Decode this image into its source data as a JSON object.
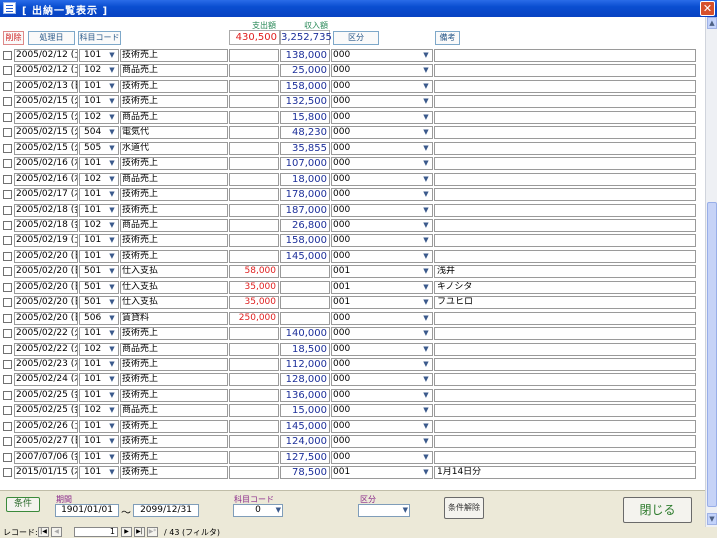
{
  "window": {
    "title": "[ 出納一覧表示 ]",
    "close_glyph": "✕"
  },
  "header": {
    "delete_label": "削除",
    "date_label": "処理日",
    "code_label": "科目コード",
    "out_label": "支出額",
    "in_label": "収入額",
    "out_total": "430,500",
    "in_total": "3,252,735",
    "kbn_label": "区分",
    "note_label": "備考"
  },
  "rows": [
    {
      "date": "2005/02/12 (土)",
      "code": "101",
      "name": "技術売上",
      "out": "",
      "in": "138,000",
      "kbn": "000",
      "note": ""
    },
    {
      "date": "2005/02/12 (土)",
      "code": "102",
      "name": "商品売上",
      "out": "",
      "in": "25,000",
      "kbn": "000",
      "note": ""
    },
    {
      "date": "2005/02/13 (日)",
      "code": "101",
      "name": "技術売上",
      "out": "",
      "in": "158,000",
      "kbn": "000",
      "note": ""
    },
    {
      "date": "2005/02/15 (火)",
      "code": "101",
      "name": "技術売上",
      "out": "",
      "in": "132,500",
      "kbn": "000",
      "note": ""
    },
    {
      "date": "2005/02/15 (火)",
      "code": "102",
      "name": "商品売上",
      "out": "",
      "in": "15,800",
      "kbn": "000",
      "note": ""
    },
    {
      "date": "2005/02/15 (火)",
      "code": "504",
      "name": "電気代",
      "out": "",
      "in": "48,230",
      "kbn": "000",
      "note": ""
    },
    {
      "date": "2005/02/15 (火)",
      "code": "505",
      "name": "水道代",
      "out": "",
      "in": "35,855",
      "kbn": "000",
      "note": ""
    },
    {
      "date": "2005/02/16 (水)",
      "code": "101",
      "name": "技術売上",
      "out": "",
      "in": "107,000",
      "kbn": "000",
      "note": ""
    },
    {
      "date": "2005/02/16 (水)",
      "code": "102",
      "name": "商品売上",
      "out": "",
      "in": "18,000",
      "kbn": "000",
      "note": ""
    },
    {
      "date": "2005/02/17 (木)",
      "code": "101",
      "name": "技術売上",
      "out": "",
      "in": "178,000",
      "kbn": "000",
      "note": ""
    },
    {
      "date": "2005/02/18 (金)",
      "code": "101",
      "name": "技術売上",
      "out": "",
      "in": "187,000",
      "kbn": "000",
      "note": ""
    },
    {
      "date": "2005/02/18 (金)",
      "code": "102",
      "name": "商品売上",
      "out": "",
      "in": "26,800",
      "kbn": "000",
      "note": ""
    },
    {
      "date": "2005/02/19 (土)",
      "code": "101",
      "name": "技術売上",
      "out": "",
      "in": "158,000",
      "kbn": "000",
      "note": ""
    },
    {
      "date": "2005/02/20 (日)",
      "code": "101",
      "name": "技術売上",
      "out": "",
      "in": "145,000",
      "kbn": "000",
      "note": ""
    },
    {
      "date": "2005/02/20 (日)",
      "code": "501",
      "name": "仕入支払",
      "out": "58,000",
      "in": "",
      "kbn": "001",
      "note": "浅井"
    },
    {
      "date": "2005/02/20 (日)",
      "code": "501",
      "name": "仕入支払",
      "out": "35,000",
      "in": "",
      "kbn": "001",
      "note": "キノシタ"
    },
    {
      "date": "2005/02/20 (日)",
      "code": "501",
      "name": "仕入支払",
      "out": "35,000",
      "in": "",
      "kbn": "001",
      "note": "フユヒロ"
    },
    {
      "date": "2005/02/20 (日)",
      "code": "506",
      "name": "賃貸料",
      "out": "250,000",
      "in": "",
      "kbn": "000",
      "note": ""
    },
    {
      "date": "2005/02/22 (火)",
      "code": "101",
      "name": "技術売上",
      "out": "",
      "in": "140,000",
      "kbn": "000",
      "note": ""
    },
    {
      "date": "2005/02/22 (火)",
      "code": "102",
      "name": "商品売上",
      "out": "",
      "in": "18,500",
      "kbn": "000",
      "note": ""
    },
    {
      "date": "2005/02/23 (水)",
      "code": "101",
      "name": "技術売上",
      "out": "",
      "in": "112,000",
      "kbn": "000",
      "note": ""
    },
    {
      "date": "2005/02/24 (木)",
      "code": "101",
      "name": "技術売上",
      "out": "",
      "in": "128,000",
      "kbn": "000",
      "note": ""
    },
    {
      "date": "2005/02/25 (金)",
      "code": "101",
      "name": "技術売上",
      "out": "",
      "in": "136,000",
      "kbn": "000",
      "note": ""
    },
    {
      "date": "2005/02/25 (金)",
      "code": "102",
      "name": "商品売上",
      "out": "",
      "in": "15,000",
      "kbn": "000",
      "note": ""
    },
    {
      "date": "2005/02/26 (土)",
      "code": "101",
      "name": "技術売上",
      "out": "",
      "in": "145,000",
      "kbn": "000",
      "note": ""
    },
    {
      "date": "2005/02/27 (日)",
      "code": "101",
      "name": "技術売上",
      "out": "",
      "in": "124,000",
      "kbn": "000",
      "note": ""
    },
    {
      "date": "2007/07/06 (金)",
      "code": "101",
      "name": "技術売上",
      "out": "",
      "in": "127,500",
      "kbn": "000",
      "note": ""
    },
    {
      "date": "2015/01/15 (木)",
      "code": "101",
      "name": "技術売上",
      "out": "",
      "in": "78,500",
      "kbn": "001",
      "note": "1月14日分"
    }
  ],
  "footer": {
    "condition_label": "条件",
    "period_label": "期間",
    "period_from": "1901/01/01",
    "period_sep": "〜",
    "period_to": "2099/12/31",
    "code_label": "科目コード",
    "code_value": "0",
    "kbn_label": "区分",
    "kbn_value": "",
    "clear_label": "条件解除",
    "close_label": "閉じる"
  },
  "navigation": {
    "record_label": "レコード:",
    "current": "1",
    "total_text": "/ 43 (フィルタ)"
  }
}
